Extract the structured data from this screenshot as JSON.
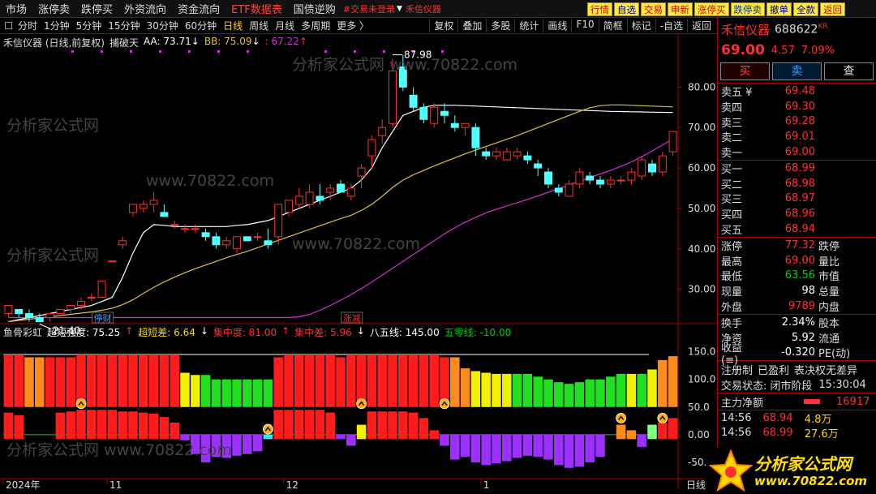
{
  "menu": [
    "市场",
    "涨停卖",
    "跌停买",
    "外资流向",
    "资金流向",
    "ETF数据表",
    "国债逆购"
  ],
  "menu_active_index": 5,
  "login_warning": "#交易未登录",
  "stock_search_label": "禾信仪器",
  "right_buttons": [
    "行情",
    "自选",
    "交易",
    "申新",
    "涨停买",
    "跌停卖",
    "撤单",
    "全款",
    "返回"
  ],
  "toolbar_periods": [
    "分时",
    "1分钟",
    "5分钟",
    "15分钟",
    "30分钟",
    "60分钟",
    "日线",
    "周线",
    "月线",
    "多周期",
    "更多 〉"
  ],
  "toolbar_selected": 6,
  "toolbar_right": [
    "复权",
    "叠加",
    "多股",
    "统计",
    "画线",
    "F10",
    "简框",
    "标记",
    "-自选",
    "返回"
  ],
  "main_legend": {
    "title": "禾信仪器 (日线,前复权)",
    "indicator": "捕破天",
    "aa": "AA: 73.71",
    "aa_arrow": "↓",
    "bb": "BB: 75.09",
    "bb_arrow": "↓",
    "cc": ": 67.22",
    "cc_arrow": "↑"
  },
  "sub_legend": {
    "name": "鱼骨彩虹",
    "items": [
      {
        "t": "超短强度: 75.25",
        "c": "#ffffff"
      },
      {
        "t": "↑",
        "c": "#ff3030"
      },
      {
        "t": "超短差: 6.64",
        "c": "#ffd700"
      },
      {
        "t": "↓",
        "c": "#ffffff"
      },
      {
        "t": "集中度: 81.00",
        "c": "#ff3030"
      },
      {
        "t": "↑",
        "c": "#ff3030"
      },
      {
        "t": "集中差: 5.96",
        "c": "#ff3030"
      },
      {
        "t": "↓",
        "c": "#ffffff"
      },
      {
        "t": "八五线: 145.00",
        "c": "#ffffff"
      },
      {
        "t": "五零线: -10.00",
        "c": "#00d000"
      }
    ]
  },
  "panel": {
    "name": "禾信仪器",
    "code": "688622",
    "kr": "KR",
    "price": "69.00",
    "change": "4.57",
    "pct": "7.09%",
    "buy_btn": "买",
    "sell_btn": "卖",
    "query_btn": "查",
    "asks": [
      {
        "l": "卖五 ¥",
        "p": "69.48"
      },
      {
        "l": "卖四",
        "p": "69.30"
      },
      {
        "l": "卖三",
        "p": "69.28"
      },
      {
        "l": "卖二",
        "p": "69.01"
      },
      {
        "l": "卖一",
        "p": "69.00"
      }
    ],
    "bids": [
      {
        "l": "买一",
        "p": "68.99"
      },
      {
        "l": "买二",
        "p": "68.98"
      },
      {
        "l": "买三",
        "p": "68.97"
      },
      {
        "l": "买四",
        "p": "68.96"
      },
      {
        "l": "买五",
        "p": "68.94"
      }
    ],
    "stats": [
      {
        "l": "涨停",
        "v": "77.32",
        "c": "",
        "l2": "跌停"
      },
      {
        "l": "最高",
        "v": "69.00",
        "c": "",
        "l2": "量比"
      },
      {
        "l": "最低",
        "v": "63.56",
        "c": "g",
        "l2": "市值"
      },
      {
        "l": "现量",
        "v": "98",
        "c": "w",
        "l2": "总量"
      },
      {
        "l": "外盘",
        "v": "9789",
        "c": "",
        "l2": "内盘"
      }
    ],
    "stats2": [
      {
        "l": "换手",
        "v": "2.34%",
        "c": "w",
        "l2": "股本"
      },
      {
        "l": "净资",
        "v": "5.92",
        "c": "w",
        "l2": "流通"
      },
      {
        "l": "收益(≡)",
        "v": "-0.320",
        "c": "w",
        "l2": "PE(动)"
      }
    ],
    "tags": [
      "注册制",
      "已盈利",
      "表决权无差异"
    ],
    "trade_status_label": "交易状态:",
    "trade_status_value": "闭市阶段",
    "trade_time": "15:30:04",
    "netflow_label": "主力净额",
    "netflow_value": "16917",
    "ticks": [
      {
        "t": "14:56",
        "p": "68.94",
        "s": "4.8万"
      },
      {
        "t": "14:56",
        "p": "68.99",
        "s": "27.6万"
      }
    ]
  },
  "logo": {
    "line1": "分析家公式网",
    "line2": "www.70822.com"
  },
  "bottom_axis_corner": "日线",
  "chart_data": {
    "type": "candlestick",
    "price_axis": [
      30.0,
      40.0,
      50.0,
      60.0,
      70.0,
      80.0
    ],
    "price_range": [
      22.5,
      89.5
    ],
    "high_label": "87.98",
    "low_label": "21.40",
    "date_labels": [
      {
        "t": "2024年",
        "i": 0
      },
      {
        "t": "11",
        "i": 10
      },
      {
        "t": "12",
        "i": 27
      },
      {
        "t": "1",
        "i": 46
      }
    ],
    "event_labels": [
      {
        "t": "停财",
        "i": 9,
        "c": "#3ba0ff"
      },
      {
        "t": "涨减",
        "i": 33,
        "c": "#ff3030"
      }
    ],
    "candles": [
      [
        24,
        26,
        23,
        26
      ],
      [
        25,
        25,
        23,
        24
      ],
      [
        24,
        25,
        22,
        23
      ],
      [
        23,
        24,
        22,
        22
      ],
      [
        23,
        24,
        22,
        24
      ],
      [
        24,
        25,
        24,
        25
      ],
      [
        25,
        26,
        24,
        26
      ],
      [
        26,
        28,
        25,
        27
      ],
      [
        28,
        29,
        27,
        28
      ],
      [
        28,
        32,
        28,
        32
      ],
      [
        37,
        37,
        37,
        37
      ],
      [
        41,
        43,
        40,
        42
      ],
      [
        49,
        51,
        48,
        51
      ],
      [
        50,
        52,
        49,
        51
      ],
      [
        51,
        54,
        49,
        52
      ],
      [
        49,
        51,
        48,
        48
      ],
      [
        46,
        47,
        45,
        46
      ],
      [
        45,
        46,
        44,
        45
      ],
      [
        45,
        46,
        44,
        45
      ],
      [
        44,
        45,
        42,
        43
      ],
      [
        43,
        44,
        40,
        41
      ],
      [
        41,
        43,
        40,
        42
      ],
      [
        40,
        43,
        39,
        43
      ],
      [
        43,
        43,
        42,
        42
      ],
      [
        43,
        44,
        42,
        43
      ],
      [
        42,
        45,
        40,
        41
      ],
      [
        43,
        51,
        41,
        51
      ],
      [
        49,
        52,
        48,
        52
      ],
      [
        51,
        55,
        50,
        53
      ],
      [
        51,
        56,
        50,
        54
      ],
      [
        53,
        56,
        51,
        52
      ],
      [
        54,
        56,
        52,
        55
      ],
      [
        56,
        57,
        54,
        54
      ],
      [
        53,
        56,
        52,
        55
      ],
      [
        58,
        61,
        55,
        60
      ],
      [
        63,
        68,
        60,
        67
      ],
      [
        68,
        72,
        66,
        70
      ],
      [
        71,
        87,
        70,
        84
      ],
      [
        85,
        88,
        79,
        80
      ],
      [
        78,
        80,
        74,
        75
      ],
      [
        75,
        76,
        71,
        72
      ],
      [
        71,
        76,
        70,
        75
      ],
      [
        74,
        76,
        71,
        73
      ],
      [
        71,
        73,
        69,
        70
      ],
      [
        70,
        71,
        68,
        71
      ],
      [
        70,
        71,
        63,
        65
      ],
      [
        64,
        65,
        62,
        63
      ],
      [
        63,
        65,
        62,
        64
      ],
      [
        62,
        65,
        62,
        64
      ],
      [
        63,
        65,
        62,
        64
      ],
      [
        63,
        64,
        61,
        62
      ],
      [
        61,
        62,
        58,
        60
      ],
      [
        59,
        60,
        55,
        56
      ],
      [
        55,
        56,
        53,
        54
      ],
      [
        53,
        57,
        53,
        56
      ],
      [
        56,
        60,
        55,
        59
      ],
      [
        58,
        59,
        56,
        57
      ],
      [
        57,
        58,
        55,
        56
      ],
      [
        56,
        58,
        55,
        57
      ],
      [
        57,
        58,
        56,
        57
      ],
      [
        57,
        60,
        56,
        59
      ],
      [
        58,
        63,
        57,
        62
      ],
      [
        61,
        62,
        58,
        59
      ],
      [
        59,
        64,
        58,
        63
      ],
      [
        64,
        69,
        63,
        69
      ]
    ],
    "series": [
      {
        "name": "AA",
        "color": "#ffffff",
        "values": [
          22,
          22.5,
          23,
          23.5,
          24,
          24.5,
          25,
          25.5,
          26,
          27,
          28,
          33,
          39,
          44,
          46,
          45.8,
          45.5,
          45.5,
          45.5,
          45.5,
          45.5,
          45.5,
          45.8,
          46,
          46.5,
          47,
          48,
          49,
          50,
          51,
          52,
          53,
          54,
          55,
          57,
          60,
          65,
          69,
          73,
          74,
          75,
          75.5,
          75.5,
          75.5,
          75.4,
          75.3,
          75.2,
          75.1,
          75,
          74.9,
          74.8,
          74.7,
          74.6,
          74.5,
          74.4,
          74.3,
          74.2,
          74.1,
          74,
          73.95,
          73.9,
          73.85,
          73.8,
          73.75,
          73.71
        ]
      },
      {
        "name": "BB",
        "color": "#e0c040",
        "values": [
          22,
          22.3,
          22.6,
          22.9,
          23.2,
          23.5,
          23.8,
          24.1,
          24.4,
          24.8,
          25.3,
          26.2,
          27.4,
          29,
          30.5,
          31.8,
          33,
          34.1,
          35.1,
          36,
          36.9,
          37.8,
          38.6,
          39.4,
          40.3,
          41.2,
          42.1,
          43,
          43.9,
          44.8,
          45.7,
          46.6,
          47.5,
          48.3,
          49.5,
          51,
          53,
          55.2,
          57,
          58.3,
          59.4,
          60.5,
          61.5,
          62.5,
          63.5,
          64.4,
          65.3,
          66.2,
          67.1,
          68,
          69,
          70,
          71,
          72,
          73,
          74,
          74.9,
          75.4,
          75.6,
          75.6,
          75.5,
          75.4,
          75.3,
          75.2,
          75.09
        ]
      },
      {
        "name": "",
        "color": "#d030d0",
        "values": [
          23,
          23,
          23,
          23,
          23,
          23,
          23,
          23,
          23,
          23,
          23,
          23,
          23,
          23,
          23,
          23,
          23,
          23,
          23,
          23,
          23,
          23,
          23,
          23,
          23,
          23,
          23,
          23,
          23.2,
          23.8,
          24.8,
          26,
          27.3,
          28.7,
          30.2,
          31.8,
          33.5,
          35.2,
          36.9,
          38.6,
          40.3,
          42,
          43.7,
          45.2,
          46.6,
          47.8,
          48.9,
          49.8,
          50.6,
          51.4,
          52.2,
          53.1,
          54,
          54.9,
          55.8,
          56.7,
          57.6,
          58.5,
          59.4,
          60.4,
          61.5,
          62.8,
          64.2,
          65.7,
          67.22
        ]
      }
    ],
    "sub_axis": [
      150.0,
      100.0,
      50.0,
      0.0,
      -50.0
    ],
    "sub_range": [
      -75,
      170
    ],
    "strength": [
      145,
      145,
      140,
      140,
      140,
      140,
      140,
      145,
      145,
      145,
      145,
      145,
      145,
      145,
      145,
      145,
      145,
      112,
      108,
      108,
      100,
      100,
      100,
      100,
      100,
      100,
      140,
      145,
      145,
      145,
      145,
      145,
      140,
      145,
      145,
      145,
      145,
      145,
      145,
      145,
      145,
      145,
      140,
      140,
      120,
      115,
      112,
      110,
      110,
      110,
      110,
      105,
      100,
      95,
      92,
      95,
      100,
      100,
      105,
      110,
      110,
      110,
      118,
      135,
      142
    ],
    "strength_colors": [
      "r",
      "r",
      "o",
      "o",
      "r",
      "r",
      "r",
      "r",
      "r",
      "r",
      "r",
      "r",
      "r",
      "r",
      "r",
      "r",
      "r",
      "y",
      "y",
      "g",
      "g",
      "g",
      "g",
      "g",
      "g",
      "g",
      "r",
      "r",
      "r",
      "r",
      "r",
      "r",
      "r",
      "r",
      "r",
      "r",
      "r",
      "r",
      "r",
      "r",
      "r",
      "r",
      "r",
      "o",
      "o",
      "y",
      "y",
      "y",
      "y",
      "g",
      "g",
      "g",
      "g",
      "g",
      "g",
      "g",
      "g",
      "g",
      "g",
      "g",
      "y",
      "g",
      "y",
      "o",
      "o"
    ],
    "concentration": [
      40,
      35,
      0,
      0,
      0,
      40,
      42,
      45,
      45,
      45,
      45,
      42,
      42,
      40,
      38,
      32,
      22,
      -10,
      -35,
      -50,
      -40,
      -42,
      -38,
      -35,
      -30,
      -8,
      45,
      45,
      45,
      45,
      45,
      40,
      -8,
      -20,
      18,
      42,
      42,
      42,
      42,
      40,
      30,
      8,
      -20,
      -45,
      -40,
      -50,
      -55,
      -52,
      -48,
      -42,
      -38,
      -40,
      -45,
      -55,
      -60,
      -58,
      -50,
      -40,
      0,
      18,
      8,
      -22,
      18,
      22,
      30
    ],
    "concentration_colors": [
      "r",
      "r",
      "x",
      "x",
      "x",
      "r",
      "r",
      "r",
      "r",
      "r",
      "r",
      "r",
      "r",
      "r",
      "r",
      "r",
      "r",
      "p",
      "p",
      "p",
      "p",
      "p",
      "p",
      "p",
      "p",
      "c",
      "r",
      "r",
      "r",
      "r",
      "r",
      "r",
      "p",
      "p",
      "y",
      "r",
      "r",
      "r",
      "r",
      "r",
      "r",
      "r",
      "p",
      "p",
      "p",
      "p",
      "p",
      "p",
      "p",
      "p",
      "p",
      "p",
      "p",
      "p",
      "p",
      "p",
      "p",
      "p",
      "x",
      "o",
      "o",
      "p",
      "l",
      "r",
      "r"
    ],
    "markers": [
      2,
      10,
      24,
      33,
      35,
      51,
      61,
      72,
      73,
      82,
      89,
      95
    ]
  }
}
